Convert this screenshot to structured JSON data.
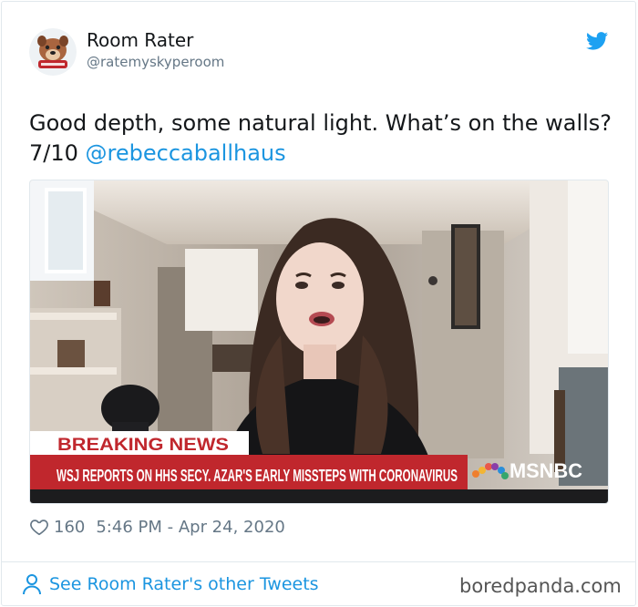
{
  "user": {
    "display_name": "Room Rater",
    "handle": "@ratemyskyperoom"
  },
  "tweet": {
    "text": "Good depth, some natural light. What’s on the walls? 7/10 ",
    "mention": "@rebeccaballhaus",
    "like_count": "160",
    "timestamp": "5:46 PM - Apr 24, 2020"
  },
  "media": {
    "breaking_label": "BREAKING NEWS",
    "headline": "WSJ REPORTS ON HHS SECY. AZAR'S EARLY MISSTEPS WITH CORONAVIRUS",
    "network": "MSNBC"
  },
  "footer": {
    "link_label": "See Room Rater's other Tweets"
  },
  "watermark": "boredpanda.com",
  "colors": {
    "link_blue": "#1b95e0",
    "twitter_blue": "#1da1f2",
    "muted_text": "#657786",
    "breaking_red": "#c0272d"
  },
  "icons": {
    "avatar": "dog-mascot-avatar",
    "brand": "twitter-bird-icon",
    "like": "heart-outline-icon",
    "profile": "person-outline-icon"
  }
}
